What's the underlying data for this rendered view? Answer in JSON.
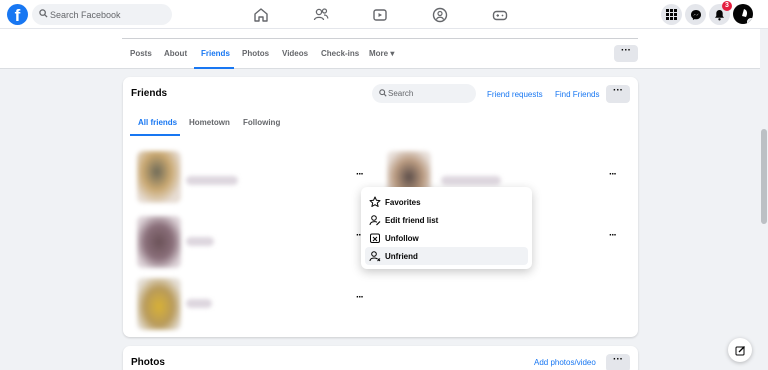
{
  "topbar": {
    "logo": "f",
    "search_placeholder": "Search Facebook",
    "notification_count": "3",
    "icons": [
      "home-icon",
      "friends-icon",
      "watch-icon",
      "groups-icon",
      "gaming-icon",
      "menu-grid-icon",
      "messenger-icon",
      "bell-icon"
    ]
  },
  "profile_tabs": {
    "items": [
      {
        "label": "Posts"
      },
      {
        "label": "About"
      },
      {
        "label": "Friends"
      },
      {
        "label": "Photos"
      },
      {
        "label": "Videos"
      },
      {
        "label": "Check-ins"
      },
      {
        "label": "More ▾"
      }
    ],
    "active": "Friends",
    "more_button": "···"
  },
  "friends_card": {
    "title": "Friends",
    "search_placeholder": "Search",
    "friend_requests": "Friend requests",
    "find_friends": "Find Friends",
    "more_button": "···",
    "subtabs": [
      {
        "label": "All friends"
      },
      {
        "label": "Hometown"
      },
      {
        "label": "Following"
      }
    ],
    "entry_menu": "···"
  },
  "context_menu": {
    "items": [
      {
        "label": "Favorites",
        "icon": "star-icon"
      },
      {
        "label": "Edit friend list",
        "icon": "edit-list-icon"
      },
      {
        "label": "Unfollow",
        "icon": "unfollow-icon"
      },
      {
        "label": "Unfriend",
        "icon": "unfriend-icon"
      }
    ],
    "hovered": "Unfriend"
  },
  "photos_card": {
    "title": "Photos",
    "add_link": "Add photos/video",
    "more_button": "···"
  },
  "colors": {
    "accent": "#1877f2",
    "background": "#f0f2f5",
    "badge": "#e41e3f"
  }
}
